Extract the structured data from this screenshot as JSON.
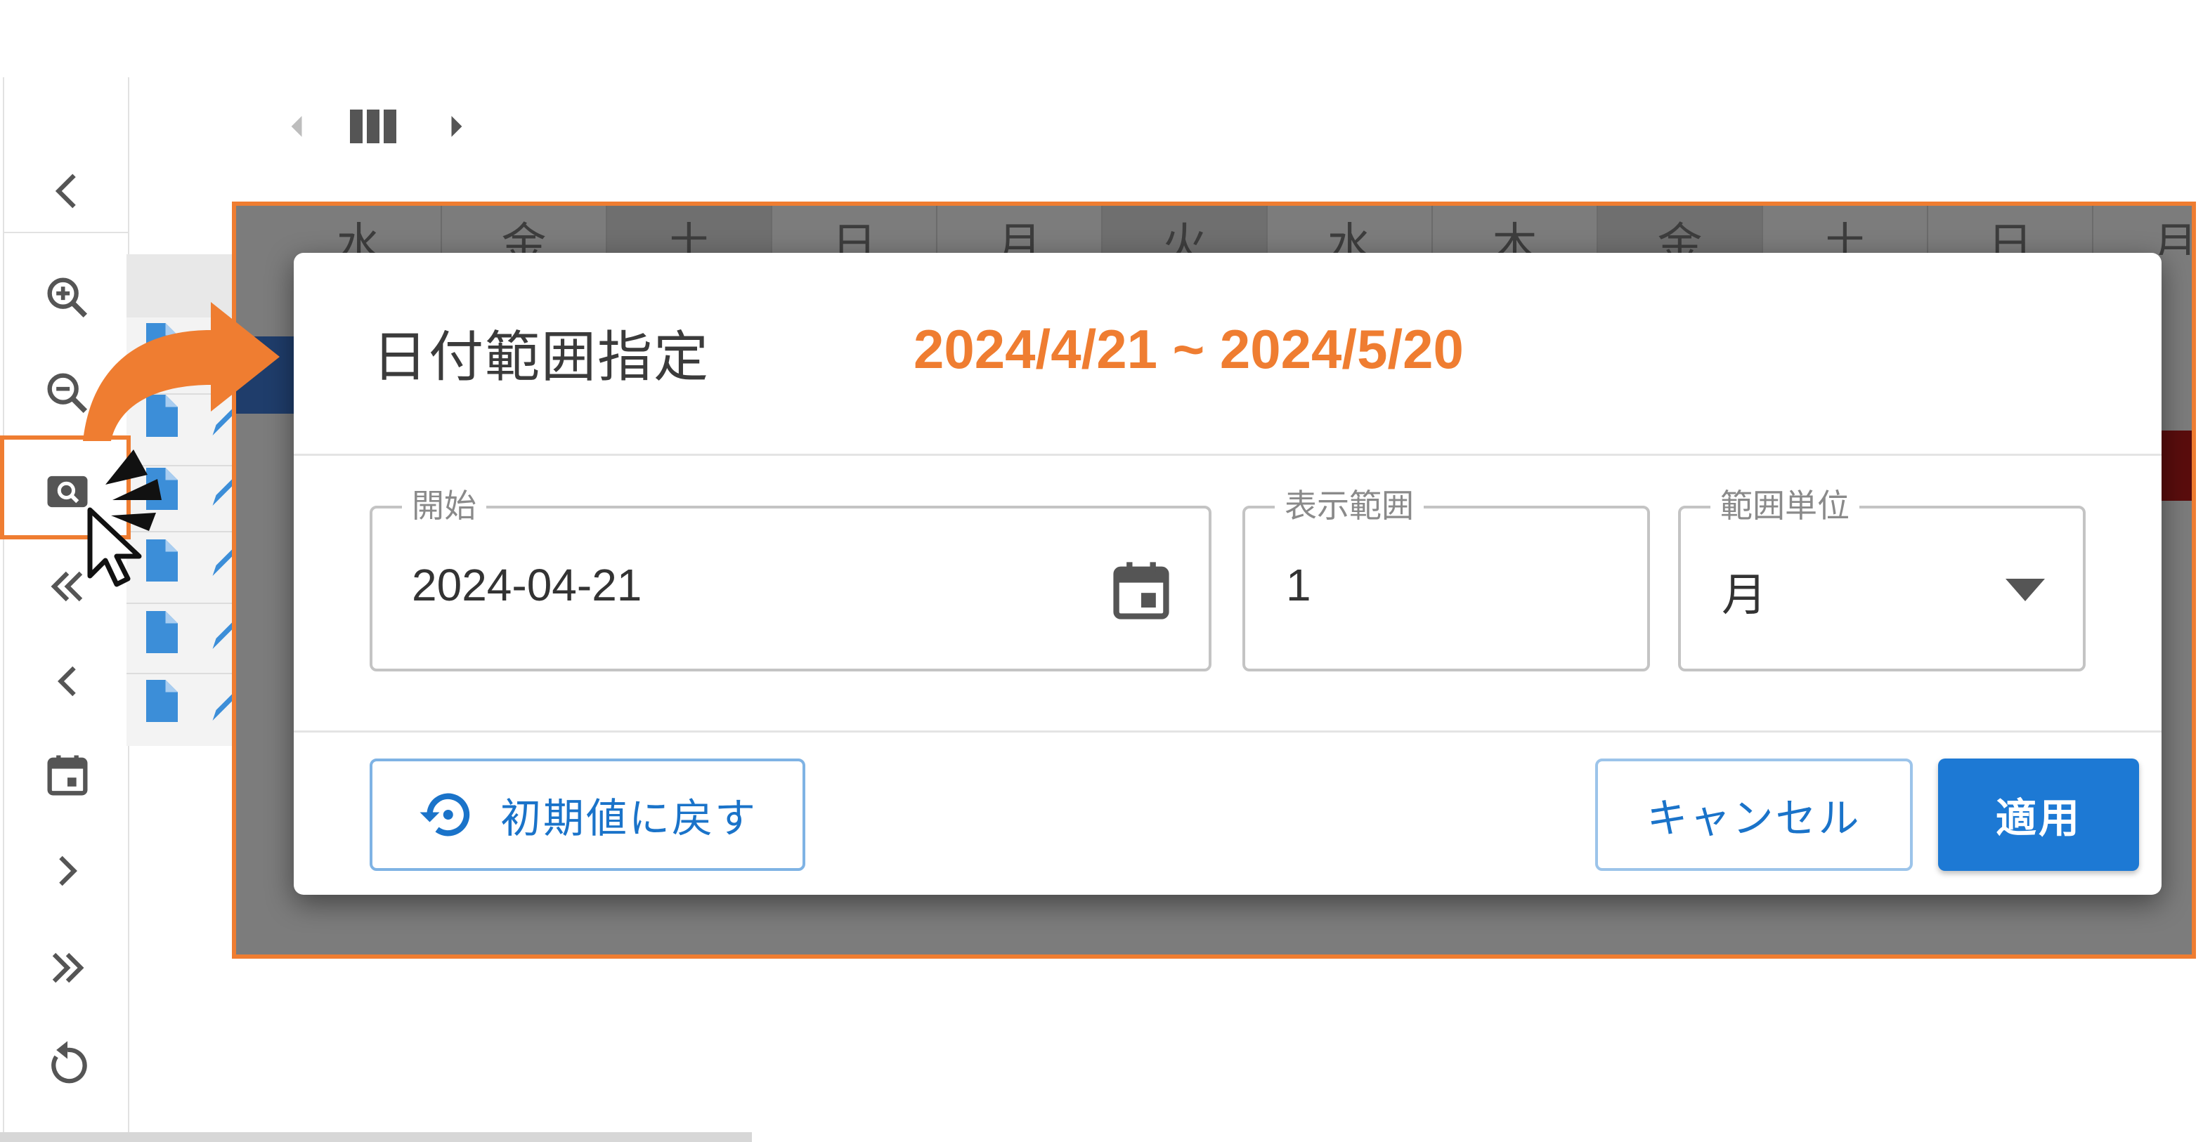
{
  "sidebar": {
    "items": [
      {
        "icon": "chevron-left-icon"
      },
      {
        "icon": "zoom-in-icon"
      },
      {
        "icon": "zoom-out-icon"
      },
      {
        "icon": "date-search-icon"
      },
      {
        "icon": "double-chevron-left-icon"
      },
      {
        "icon": "chevron-left-icon"
      },
      {
        "icon": "calendar-icon"
      },
      {
        "icon": "chevron-right-icon"
      },
      {
        "icon": "double-chevron-right-icon"
      },
      {
        "icon": "refresh-icon"
      }
    ]
  },
  "calendar_nav": {
    "prev_icon": "triangle-left-icon",
    "columns_icon": "columns-icon",
    "next_icon": "triangle-right-icon"
  },
  "background_calendar": {
    "weekdays": [
      "水",
      "金",
      "土",
      "日",
      "月",
      "火",
      "水",
      "木",
      "金",
      "土",
      "日",
      "月"
    ]
  },
  "dialog": {
    "title": "日付範囲指定",
    "range_annotation": "2024/4/21 ~ 2024/5/20",
    "start_field": {
      "label": "開始",
      "value": "2024-04-21"
    },
    "range_field": {
      "label": "表示範囲",
      "value": "1"
    },
    "unit_field": {
      "label": "範囲単位",
      "value": "月"
    },
    "reset_button": "初期値に戻す",
    "cancel_button": "キャンセル",
    "apply_button": "適用"
  },
  "colors": {
    "accent_orange": "#ef7d31",
    "primary_blue": "#1d79d4",
    "icon_gray": "#555555"
  }
}
